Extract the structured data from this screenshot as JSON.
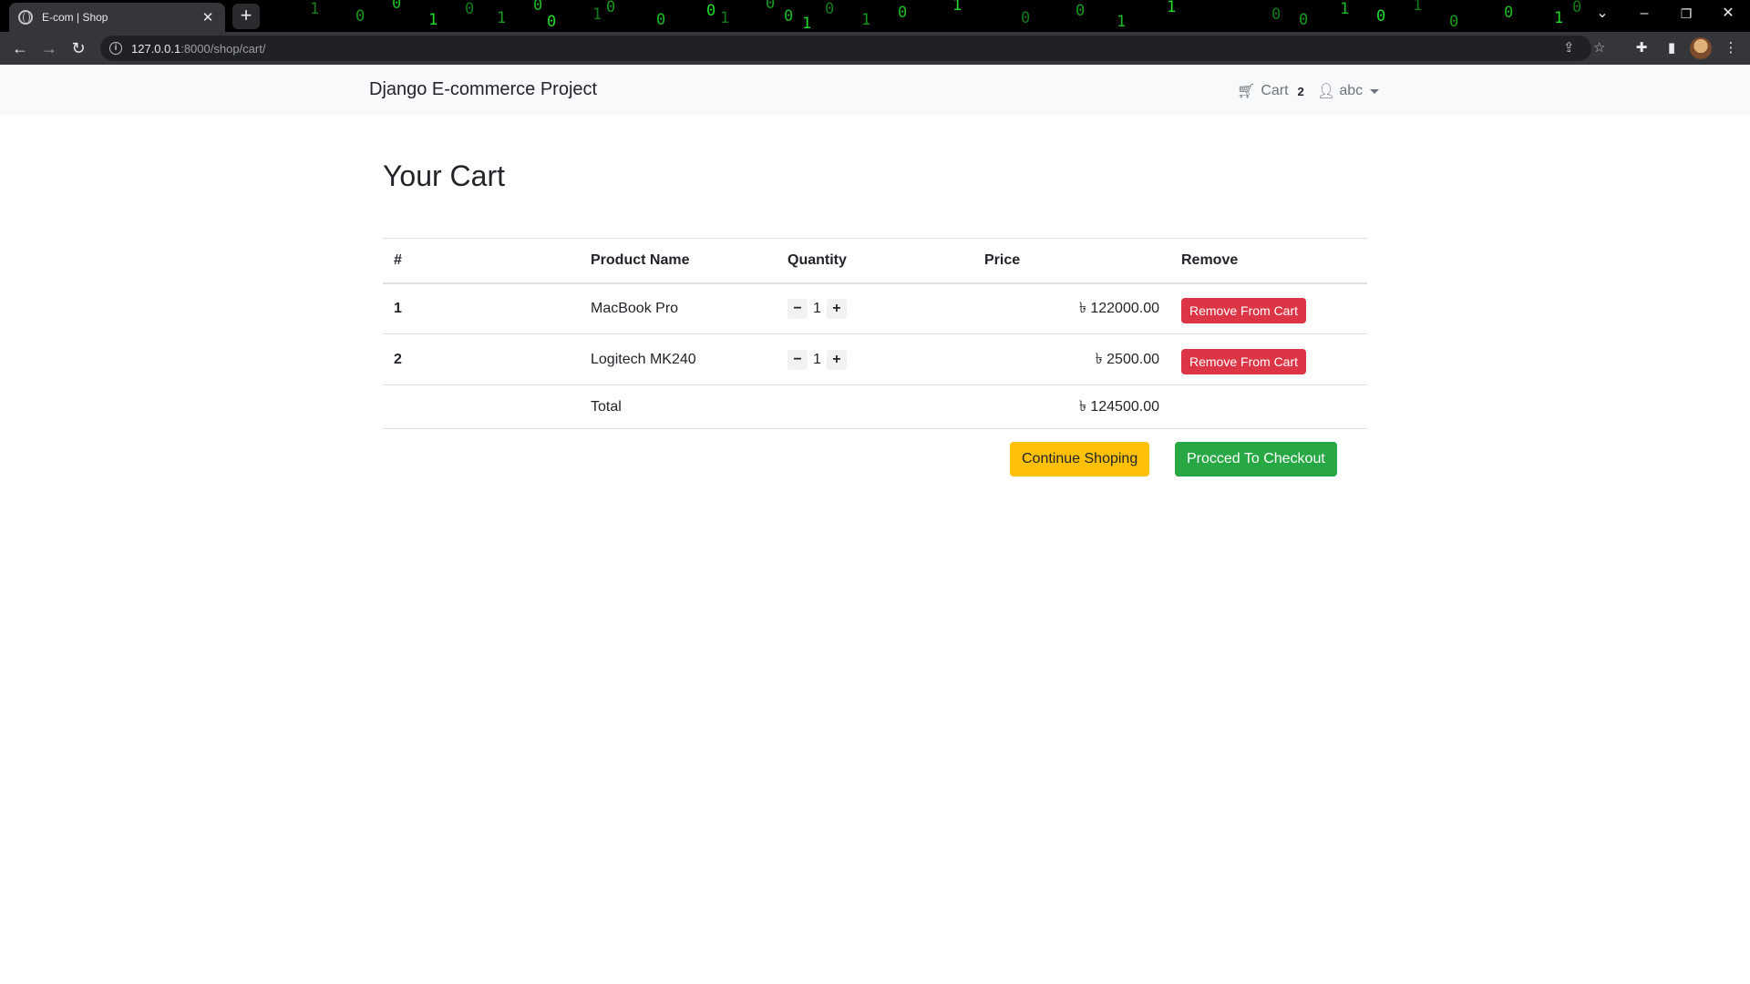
{
  "browser": {
    "tab_title": "E-com | Shop",
    "tab_close": "✕",
    "new_tab": "+",
    "url_host": "127.0.0.1",
    "url_rest": ":8000/shop/cart/",
    "matrix_digits": [
      "1",
      "0",
      "0",
      "1",
      "0",
      "1",
      "0",
      "0",
      "1",
      "0",
      "0",
      "0",
      "1",
      "0",
      "0",
      "1",
      "0",
      "1",
      "0",
      "1",
      "0",
      "0",
      "1",
      "1",
      "0",
      "0",
      "1",
      "0",
      "1",
      "0",
      "0",
      "1",
      "0"
    ]
  },
  "navbar": {
    "brand": "Django E-commerce Project",
    "cart_label": "Cart",
    "cart_count": "2",
    "user_label": "abc"
  },
  "page": {
    "title": "Your Cart"
  },
  "table": {
    "headers": [
      "#",
      "Product Name",
      "Quantity",
      "Price",
      "Remove"
    ],
    "rows": [
      {
        "num": "1",
        "name": "MacBook Pro",
        "qty": "1",
        "price": "৳ 122000.00",
        "remove": "Remove From Cart"
      },
      {
        "num": "2",
        "name": "Logitech MK240",
        "qty": "1",
        "price": "৳ 2500.00",
        "remove": "Remove From Cart"
      }
    ],
    "total_label": "Total",
    "total_value": "৳ 124500.00",
    "qty_minus": "−",
    "qty_plus": "+"
  },
  "actions": {
    "continue": "Continue Shoping",
    "checkout": "Procced To Checkout"
  },
  "colors": {
    "danger": "#dc3545",
    "warning": "#ffc107",
    "success": "#28a745",
    "matrix_green": "#1fdc2a"
  }
}
